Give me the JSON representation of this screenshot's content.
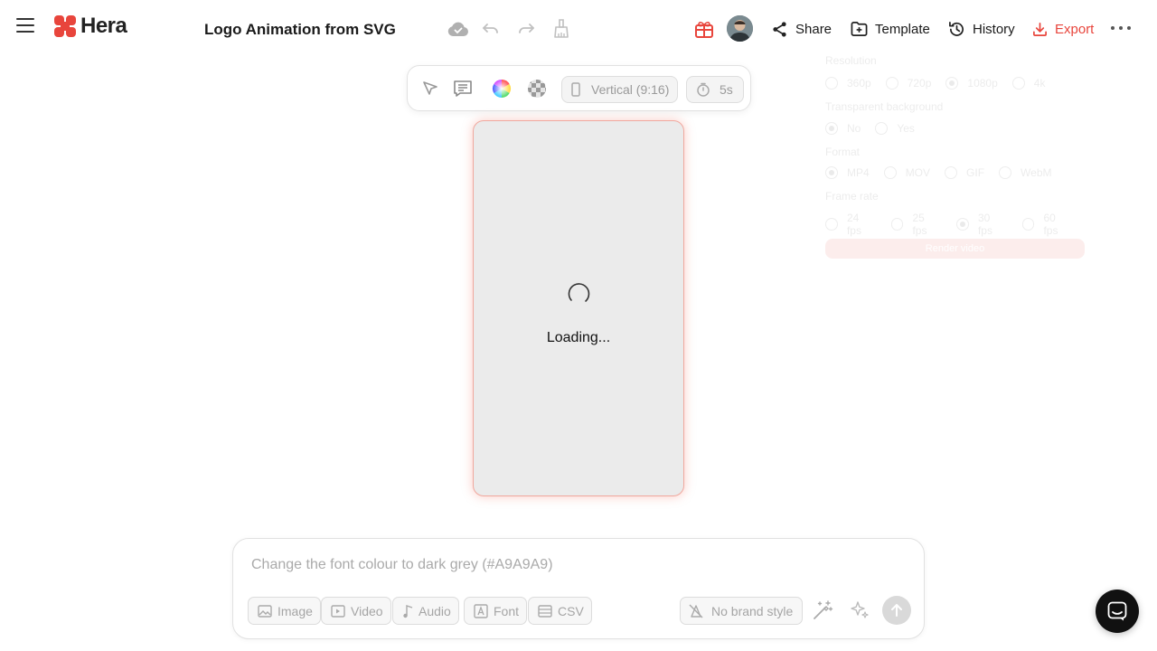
{
  "app": {
    "name": "Hera"
  },
  "header": {
    "title": "Logo Animation from SVG",
    "share_label": "Share",
    "template_label": "Template",
    "history_label": "History",
    "export_label": "Export"
  },
  "toolbar": {
    "aspect_label": "Vertical (9:16)",
    "duration_label": "5s"
  },
  "canvas": {
    "loading_text": "Loading..."
  },
  "export_panel": {
    "resolution_label": "Resolution",
    "resolution_options": [
      "360p",
      "720p",
      "1080p",
      "4k"
    ],
    "transparent_label": "Transparent background",
    "transparent_options": [
      "No",
      "Yes"
    ],
    "format_label": "Format",
    "format_options": [
      "MP4",
      "MOV",
      "GIF",
      "WebM"
    ],
    "framerate_label": "Frame rate",
    "framerate_options": [
      "24 fps",
      "25 fps",
      "30 fps",
      "60 fps"
    ],
    "button_label": "Render video"
  },
  "prompt": {
    "placeholder": "Change the font colour to dark grey (#A9A9A9)",
    "attachments": {
      "image": "Image",
      "video": "Video",
      "audio": "Audio",
      "font": "Font",
      "csv": "CSV"
    },
    "brand_style_label": "No brand style"
  },
  "colors": {
    "accent": "#e8453c",
    "canvas_bg": "#ebebeb",
    "brand": "#e8453c"
  }
}
